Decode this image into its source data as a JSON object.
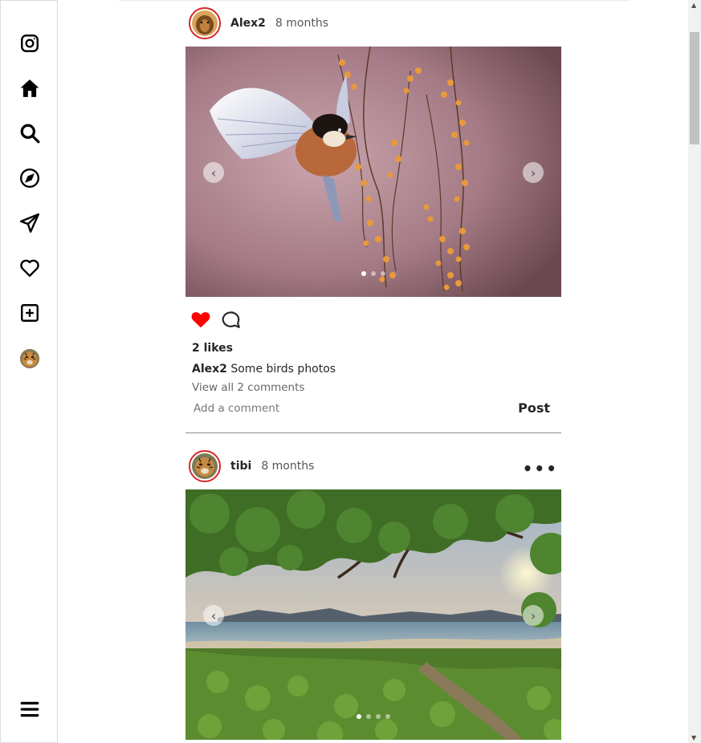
{
  "sidebar": {
    "items": [
      {
        "name": "instagram-logo-icon"
      },
      {
        "name": "home-icon"
      },
      {
        "name": "search-icon"
      },
      {
        "name": "explore-compass-icon"
      },
      {
        "name": "messages-send-icon"
      },
      {
        "name": "notifications-heart-icon"
      },
      {
        "name": "create-plus-icon"
      },
      {
        "name": "profile-avatar"
      }
    ],
    "menu_icon": "hamburger-menu-icon"
  },
  "posts": [
    {
      "username": "Alex2",
      "time": "8 months",
      "likes": "2 likes",
      "caption_user": "Alex2",
      "caption_text": " Some birds photos",
      "view_comments": "View all 2 comments",
      "comment_placeholder": "Add a comment",
      "post_label": "Post",
      "slide_count": 3,
      "active_slide": 1,
      "liked": true
    },
    {
      "username": "tibi",
      "time": "8 months",
      "more_label": "•••",
      "slide_count": 4,
      "active_slide": 1
    }
  ],
  "colors": {
    "like_red": "#ff0000",
    "avatar_ring": "#d62828",
    "text": "#262626"
  },
  "arrows": {
    "prev": "‹",
    "next": "›"
  }
}
